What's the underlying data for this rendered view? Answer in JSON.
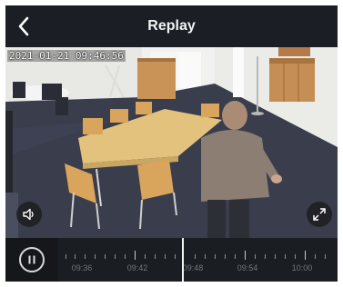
{
  "header": {
    "title": "Replay"
  },
  "video": {
    "timestamp": "2021-01-21 09:46:56"
  },
  "timeline": {
    "labels": [
      "09:36",
      "09:42",
      "09:48",
      "09:54",
      "10:00"
    ]
  },
  "icons": {
    "back": "chevron-left-icon",
    "volume": "speaker-icon",
    "fullscreen": "fullscreen-icon",
    "pause": "pause-icon"
  }
}
